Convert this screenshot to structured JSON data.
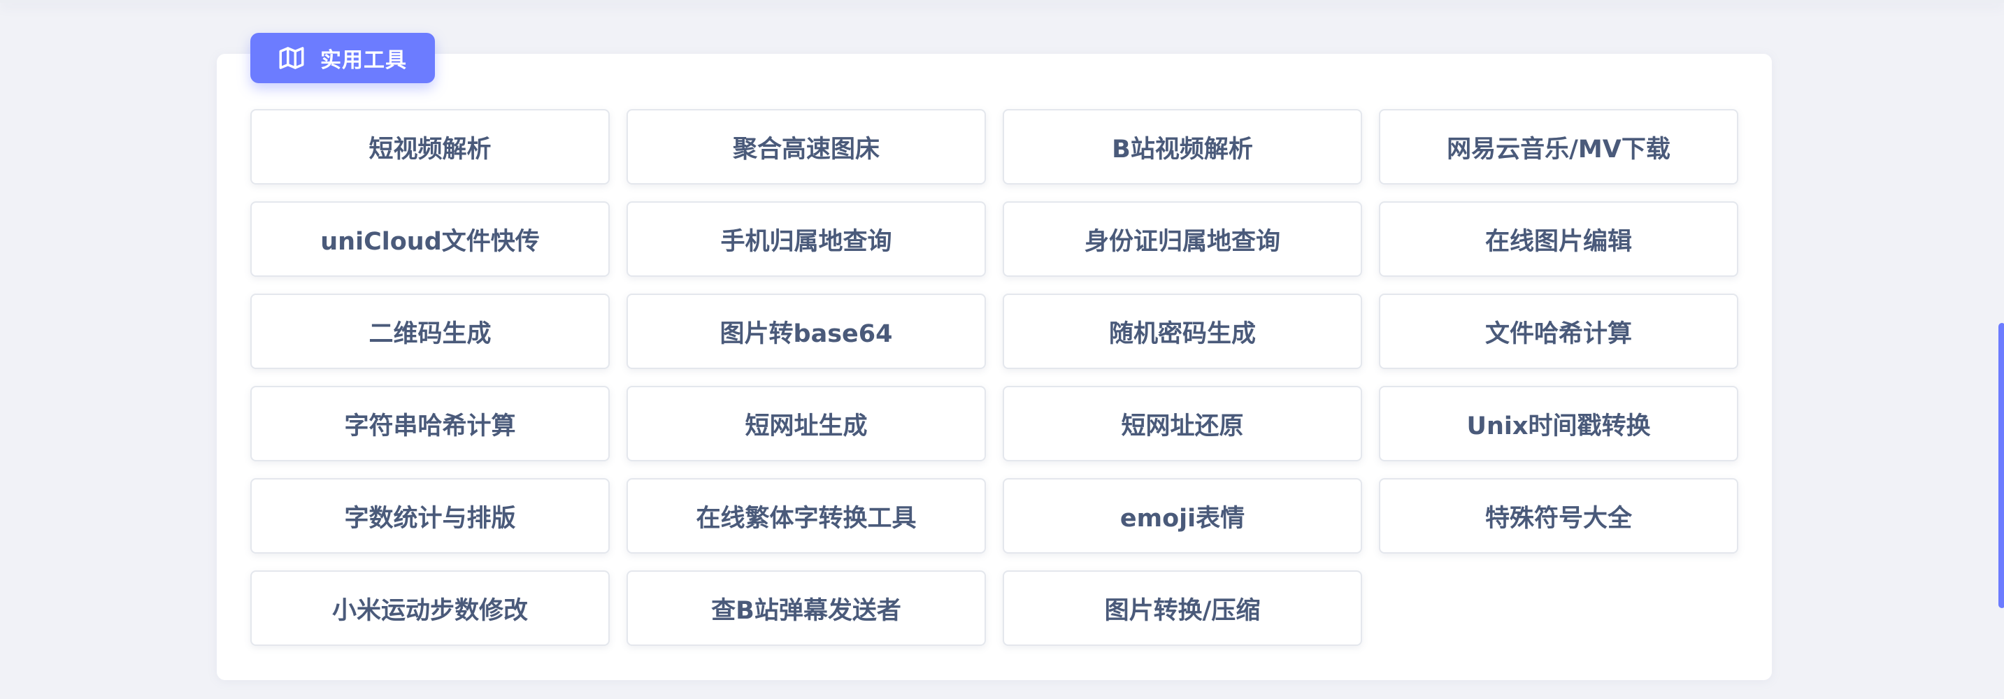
{
  "section": {
    "title": "实用工具",
    "icon": "map-icon",
    "accent_color": "#6c7cff"
  },
  "tools": [
    "短视频解析",
    "聚合高速图床",
    "B站视频解析",
    "网易云音乐/MV下载",
    "uniCloud文件快传",
    "手机归属地查询",
    "身份证归属地查询",
    "在线图片编辑",
    "二维码生成",
    "图片转base64",
    "随机密码生成",
    "文件哈希计算",
    "字符串哈希计算",
    "短网址生成",
    "短网址还原",
    "Unix时间戳转换",
    "字数统计与排版",
    "在线繁体字转换工具",
    "emoji表情",
    "特殊符号大全",
    "小米运动步数修改",
    "查B站弹幕发送者",
    "图片转换/压缩"
  ]
}
